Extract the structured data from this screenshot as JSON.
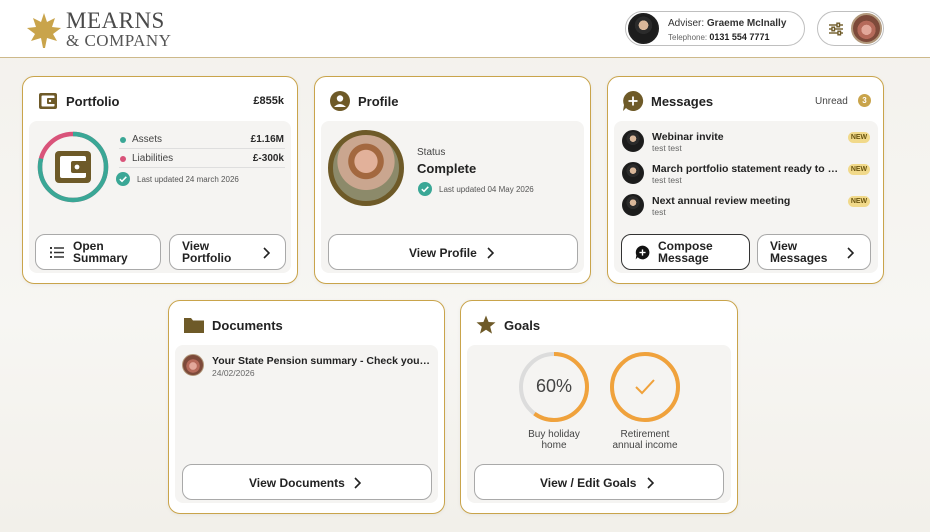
{
  "header": {
    "logo_line1": "MEARNS",
    "logo_line2": "& COMPANY",
    "adviser_label": "Adviser:",
    "adviser_name": "Graeme McInally",
    "telephone_label": "Telephone:",
    "telephone": "0131 554 7771"
  },
  "portfolio": {
    "title": "Portfolio",
    "total": "£855k",
    "assets_label": "Assets",
    "assets_value": "£1.16M",
    "liabilities_label": "Liabilities",
    "liabilities_value": "£-300k",
    "last_updated": "Last updated 24 march 2026",
    "open_summary_btn": "Open\nSummary",
    "view_portfolio_btn": "View\nPortfolio",
    "assets_fraction": 0.79
  },
  "profile": {
    "title": "Profile",
    "status_label": "Status",
    "status_value": "Complete",
    "last_updated": "Last updated 04 May 2026",
    "view_profile_btn": "View Profile"
  },
  "messages": {
    "title": "Messages",
    "unread_label": "Unread",
    "unread_count": "3",
    "items": [
      {
        "title": "Webinar invite",
        "sub": "test test",
        "badge": "NEW"
      },
      {
        "title": "March portfolio statement ready to view",
        "sub": "test test",
        "badge": "NEW"
      },
      {
        "title": "Next annual review meeting",
        "sub": "test",
        "badge": "NEW"
      }
    ],
    "compose_btn": "Compose\nMessage",
    "view_messages_btn": "View\nMessages"
  },
  "documents": {
    "title": "Documents",
    "items": [
      {
        "title": "Your State Pension summary - Check your State Pension",
        "date": "24/02/2026"
      }
    ],
    "view_documents_btn": "View Documents"
  },
  "goals": {
    "title": "Goals",
    "items": [
      {
        "value": "60%",
        "progress": 0.6,
        "label1": "Buy holiday",
        "label2": "home"
      },
      {
        "value": "",
        "progress": 1.0,
        "label1": "Retirement",
        "label2": "annual income"
      }
    ],
    "view_goals_btn": "View / Edit Goals"
  },
  "colors": {
    "gold": "#c9a44b",
    "olive": "#6e5a28",
    "teal": "#3aa796",
    "pink": "#d9537a",
    "orange": "#f0a23c"
  }
}
